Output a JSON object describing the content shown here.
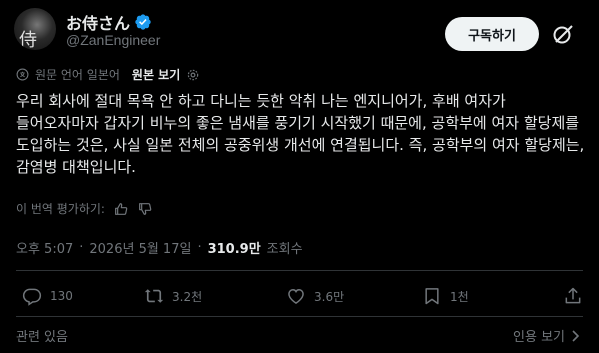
{
  "author": {
    "display_name": "お侍さん",
    "handle": "@ZanEngineer",
    "avatar_glyph": "侍"
  },
  "subscribe_label": "구독하기",
  "translation": {
    "original_language": "원문 언어 일본어",
    "show_original": "원본 보기"
  },
  "body_text": "우리 회사에 절대 목욕 안 하고 다니는 듯한 악취 나는 엔지니어가, 후배 여자가 들어오자마자 갑자기 비누의 좋은 냄새를 풍기기 시작했기 때문에, 공학부에 여자 할당제를 도입하는 것은, 사실 일본 전체의 공중위생 개선에 연결됩니다. 즉, 공학부의 여자 할당제는, 감염병 대책입니다.",
  "rate_translation": "이 번역 평가하기:",
  "meta": {
    "time": "오후 5:07",
    "date": "2026년 5월 17일",
    "views_count": "310.9만",
    "views_label": "조회수"
  },
  "actions": {
    "replies": "130",
    "reposts": "3.2천",
    "likes": "3.6만",
    "bookmarks": "1천"
  },
  "footer": {
    "related": "관련 있음",
    "quotes": "인용 보기"
  },
  "colors": {
    "background": "#000000",
    "text": "#e7e9ea",
    "muted": "#71767b",
    "verified": "#1d9bf0"
  }
}
